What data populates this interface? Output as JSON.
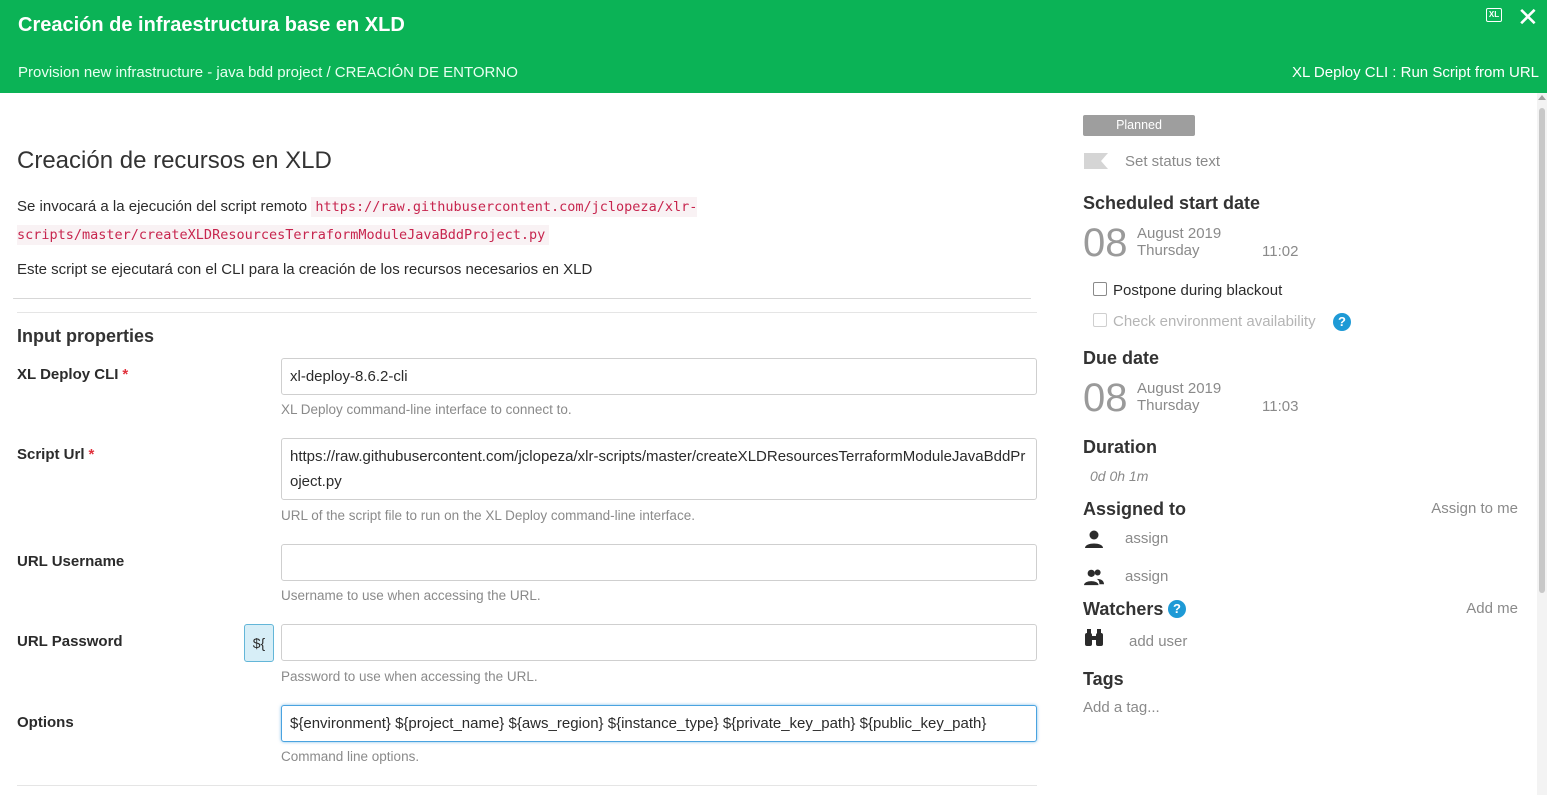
{
  "header": {
    "title": "Creación de infraestructura base en XLD",
    "breadcrumb": "Provision new infrastructure - java bdd project / CREACIÓN DE ENTORNO",
    "task_type": "XL Deploy CLI : Run Script from URL",
    "xl_icon_text": "XL",
    "close_symbol": "✕"
  },
  "description": {
    "heading": "Creación de recursos en XLD",
    "line1_text": "Se invocará a la ejecución del script remoto ",
    "line1_code": "https://raw.githubusercontent.com/jclopeza/xlr-scripts/master/createXLDResourcesTerraformModuleJavaBddProject.py",
    "line2": "Este script se ejecutará con el CLI para la creación de los recursos necesarios en XLD"
  },
  "input_properties": {
    "heading": "Input properties",
    "required_mark": "*",
    "var_button": "${",
    "fields": [
      {
        "label": "XL Deploy CLI",
        "required": true,
        "value": "xl-deploy-8.6.2-cli",
        "help": "XL Deploy command-line interface to connect to."
      },
      {
        "label": "Script Url",
        "required": true,
        "value": "https://raw.githubusercontent.com/jclopeza/xlr-scripts/master/createXLDResourcesTerraformModuleJavaBddProject.py",
        "help": "URL of the script file to run on the XL Deploy command-line interface."
      },
      {
        "label": "URL Username",
        "required": false,
        "value": "",
        "help": "Username to use when accessing the URL."
      },
      {
        "label": "URL Password",
        "required": false,
        "value": "",
        "help": "Password to use when accessing the URL."
      },
      {
        "label": "Options",
        "required": false,
        "value": "${environment} ${project_name} ${aws_region} ${instance_type} ${private_key_path} ${public_key_path}",
        "help": "Command line options."
      }
    ]
  },
  "sidebar": {
    "status": "Planned",
    "set_status_text": "Set status text",
    "scheduled_start": {
      "heading": "Scheduled start date",
      "day": "08",
      "month_year": "August 2019",
      "weekday": "Thursday",
      "time": "11:02"
    },
    "postpone_label": "Postpone during blackout",
    "check_env_label": "Check environment availability",
    "help_symbol": "?",
    "due_date": {
      "heading": "Due date",
      "day": "08",
      "month_year": "August 2019",
      "weekday": "Thursday",
      "time": "11:03"
    },
    "duration": {
      "heading": "Duration",
      "value": "0d 0h 1m"
    },
    "assigned_to": {
      "heading": "Assigned to",
      "assign_to_me": "Assign to me",
      "user_assign": "assign",
      "team_assign": "assign"
    },
    "watchers": {
      "heading": "Watchers",
      "add_me": "Add me",
      "add_user": "add user"
    },
    "tags": {
      "heading": "Tags",
      "placeholder": "Add a tag..."
    }
  },
  "colors": {
    "header_bg": "#0bb356",
    "required": "#e0313c",
    "help_icon": "#1e9ad6",
    "status_badge": "#9e9e9e"
  }
}
